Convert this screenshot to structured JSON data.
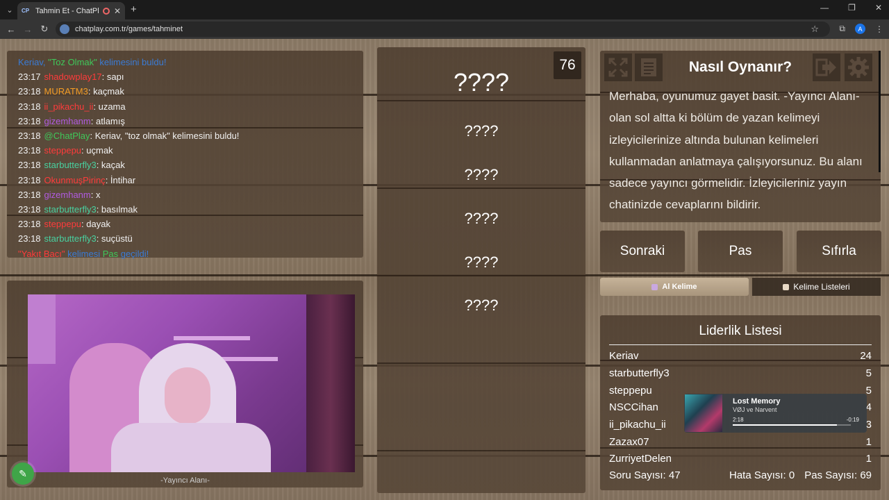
{
  "browser": {
    "tab_favicon": "CP",
    "tab_title": "Tahmin Et - ChatPlay",
    "url": "chatplay.com.tr/games/tahminet",
    "profile_initial": "A"
  },
  "chat": {
    "lines": [
      {
        "time": "",
        "segments": [
          {
            "text": "Keriav, ",
            "color": "#3a7bd5"
          },
          {
            "text": "\"Toz Olmak\"",
            "color": "#3fc85a"
          },
          {
            "text": " kelimesini buldu!",
            "color": "#3a7bd5"
          }
        ]
      },
      {
        "time": "23:17",
        "segments": [
          {
            "text": "shadowplay17",
            "color": "#ff3b3b"
          },
          {
            "text": ": sapı",
            "color": "#f2f2f2"
          }
        ]
      },
      {
        "time": "23:18",
        "segments": [
          {
            "text": "MURATM3",
            "color": "#f39c25"
          },
          {
            "text": ": kaçmak",
            "color": "#f2f2f2"
          }
        ]
      },
      {
        "time": "23:18",
        "segments": [
          {
            "text": "ii_pikachu_ii",
            "color": "#ff3b3b"
          },
          {
            "text": ": uzama",
            "color": "#f2f2f2"
          }
        ]
      },
      {
        "time": "23:18",
        "segments": [
          {
            "text": "gizemhanm",
            "color": "#b05be0"
          },
          {
            "text": ": atlamış",
            "color": "#f2f2f2"
          }
        ]
      },
      {
        "time": "23:18",
        "segments": [
          {
            "text": "@ChatPlay",
            "color": "#3fc85a"
          },
          {
            "text": ": Keriav, \"toz olmak\" kelimesini buldu!",
            "color": "#f2f2f2"
          }
        ]
      },
      {
        "time": "23:18",
        "segments": [
          {
            "text": "steppepu",
            "color": "#ff3b3b"
          },
          {
            "text": ": uçmak",
            "color": "#f2f2f2"
          }
        ]
      },
      {
        "time": "23:18",
        "segments": [
          {
            "text": "starbutterfly3",
            "color": "#48d1a0"
          },
          {
            "text": ": kaçak",
            "color": "#f2f2f2"
          }
        ]
      },
      {
        "time": "23:18",
        "segments": [
          {
            "text": "OkunmuşPirinç",
            "color": "#ff3b3b"
          },
          {
            "text": ": İntihar",
            "color": "#f2f2f2"
          }
        ]
      },
      {
        "time": "23:18",
        "segments": [
          {
            "text": "gizemhanm",
            "color": "#b05be0"
          },
          {
            "text": ": x",
            "color": "#f2f2f2"
          }
        ]
      },
      {
        "time": "23:18",
        "segments": [
          {
            "text": "starbutterfly3",
            "color": "#48d1a0"
          },
          {
            "text": ": basılmak",
            "color": "#f2f2f2"
          }
        ]
      },
      {
        "time": "23:18",
        "segments": [
          {
            "text": "steppepu",
            "color": "#ff3b3b"
          },
          {
            "text": ": dayak",
            "color": "#f2f2f2"
          }
        ]
      },
      {
        "time": "23:18",
        "segments": [
          {
            "text": "starbutterfly3",
            "color": "#48d1a0"
          },
          {
            "text": ": suçüstü",
            "color": "#f2f2f2"
          }
        ]
      },
      {
        "time": "",
        "segments": [
          {
            "text": "\"Yakıt Bacı\"",
            "color": "#ff3b3b"
          },
          {
            "text": " kelimesi ",
            "color": "#3a7bd5"
          },
          {
            "text": "Pas",
            "color": "#3fc85a"
          },
          {
            "text": " geçildi!",
            "color": "#3a7bd5"
          }
        ]
      }
    ]
  },
  "streamer": {
    "label": "-Yayıncı Alanı-"
  },
  "words": {
    "timer": "76",
    "main": "????",
    "taboo": [
      "????",
      "????",
      "????",
      "????",
      "????"
    ]
  },
  "howto": {
    "title": "Nasıl Oynanır?",
    "body": "Merhaba, oyunumuz gayet basit. -Yayıncı Alanı- olan sol altta ki bölüm de yazan kelimeyi izleyicilerinize altında bulunan kelimeleri kullanmadan anlatmaya çalışıyorsunuz. Bu alanı sadece yayıncı görmelidir. İzleyicileriniz yayın chatinizde cevaplarını bildirir."
  },
  "actions": {
    "next": "Sonraki",
    "pass": "Pas",
    "reset": "Sıfırla",
    "get_word": "Al Kelime",
    "word_lists": "Kelime Listeleri"
  },
  "leaderboard": {
    "title": "Liderlik Listesi",
    "rows": [
      {
        "name": "Keriav",
        "score": "24"
      },
      {
        "name": "starbutterfly3",
        "score": "5"
      },
      {
        "name": "steppepu",
        "score": "5"
      },
      {
        "name": "NSCCihan",
        "score": "4"
      },
      {
        "name": "ii_pikachu_ii",
        "score": "3"
      },
      {
        "name": "Zazax07",
        "score": "1"
      },
      {
        "name": "ZurriyetDelen",
        "score": "1"
      }
    ],
    "question_count": "Soru Sayısı: 47",
    "error_count": "Hata Sayısı: 0",
    "pass_count": "Pas Sayısı: 69"
  },
  "media": {
    "title": "Lost Memory",
    "artist": "VØJ ve Narvent",
    "current": "2:18",
    "remaining": "-0:19",
    "progress": 0.88
  }
}
